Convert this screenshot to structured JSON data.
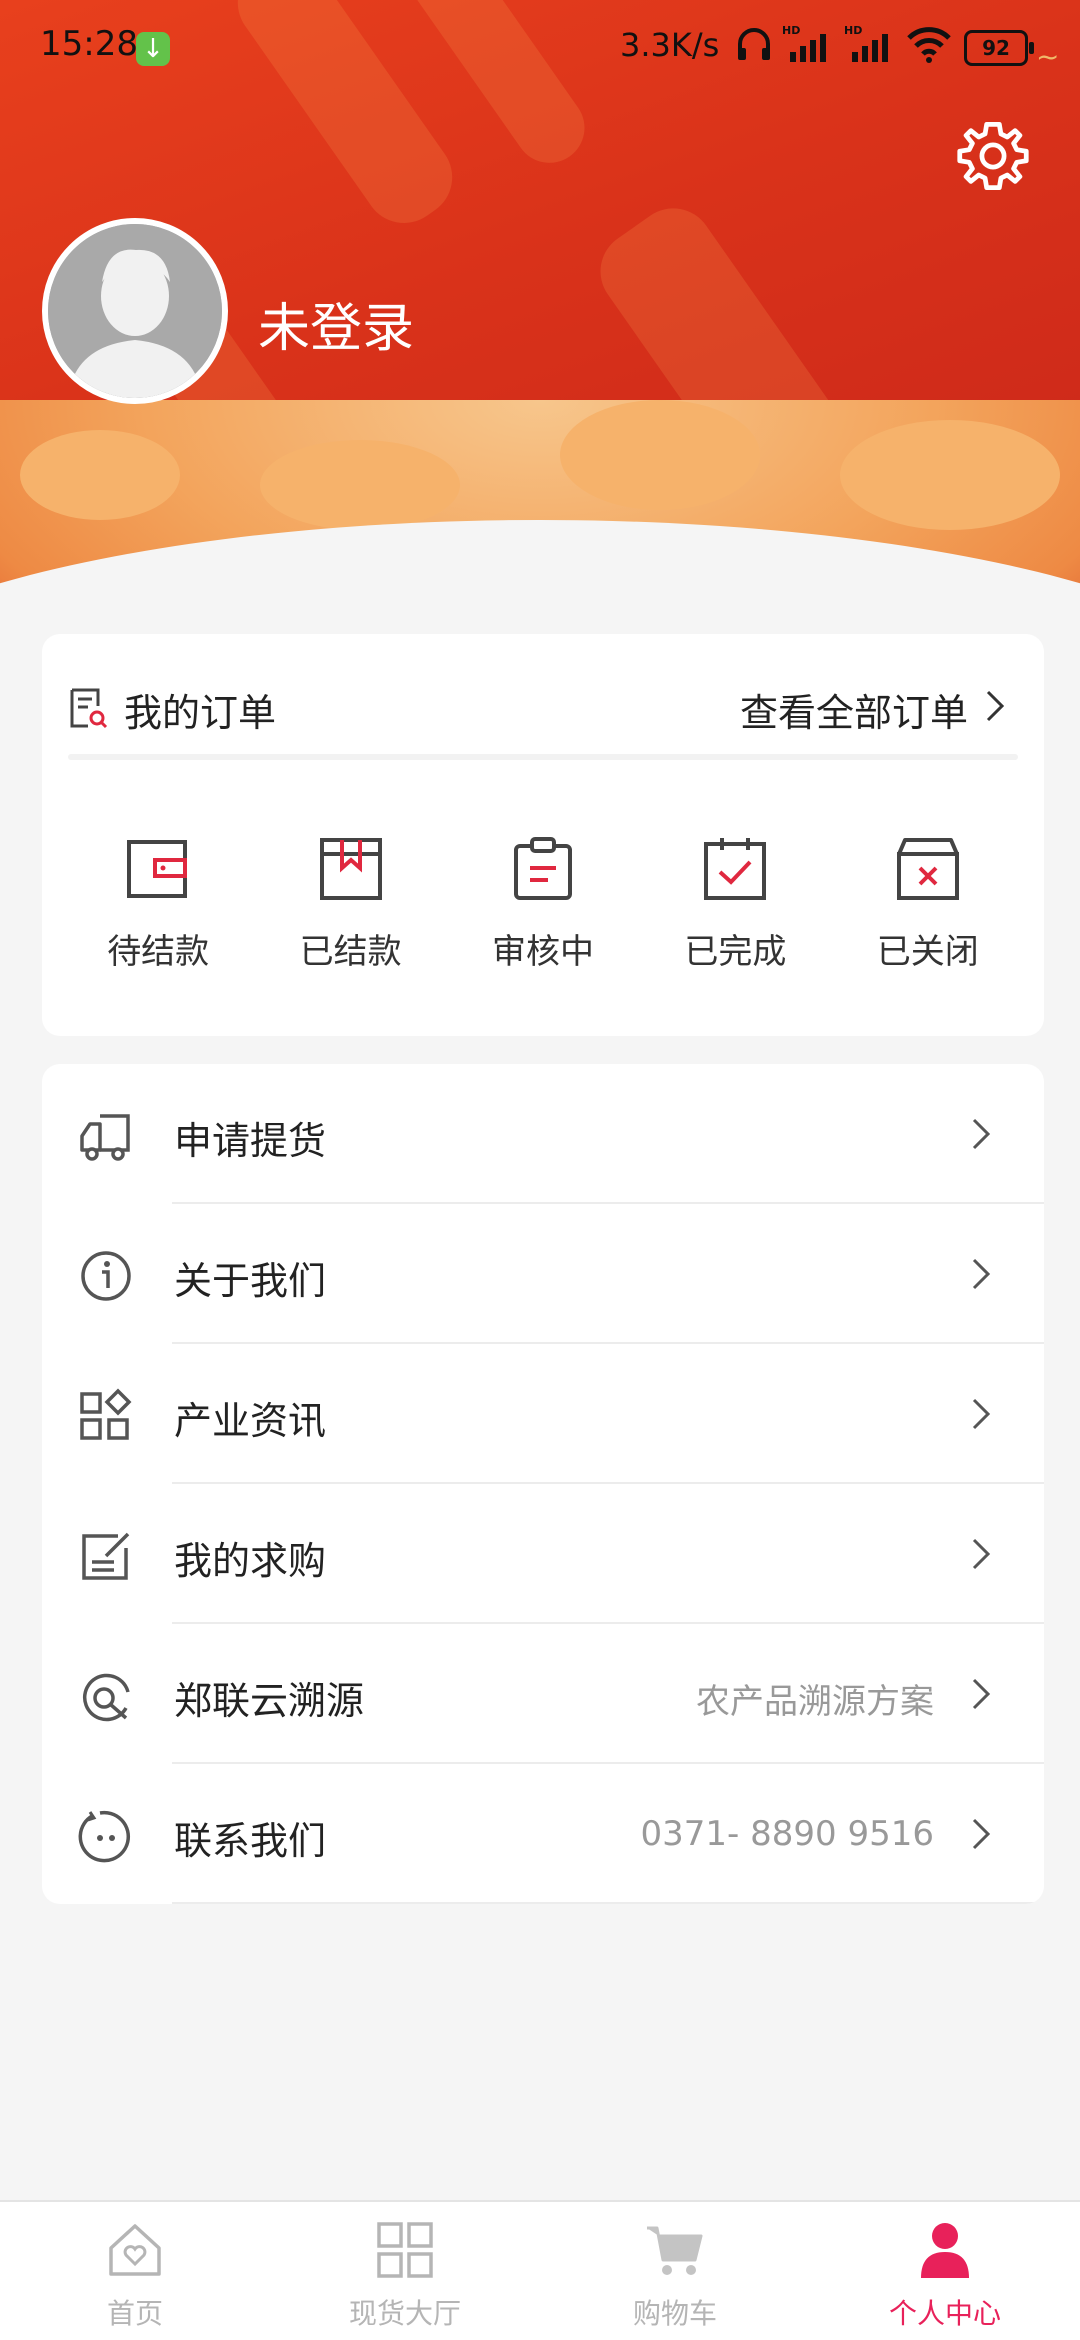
{
  "status_bar": {
    "time": "15:28",
    "speed": "3.3K/s",
    "battery": "92"
  },
  "profile": {
    "login_label": "未登录"
  },
  "orders": {
    "title": "我的订单",
    "view_all": "查看全部订单",
    "statuses": [
      {
        "label": "待结款",
        "icon": "wallet-icon"
      },
      {
        "label": "已结款",
        "icon": "bookmark-box-icon"
      },
      {
        "label": "审核中",
        "icon": "clipboard-icon"
      },
      {
        "label": "已完成",
        "icon": "calendar-check-icon"
      },
      {
        "label": "已关闭",
        "icon": "box-x-icon"
      }
    ]
  },
  "menu": [
    {
      "label": "申请提货",
      "value": "",
      "icon": "truck-icon"
    },
    {
      "label": "关于我们",
      "value": "",
      "icon": "info-icon"
    },
    {
      "label": "产业资讯",
      "value": "",
      "icon": "grid-diamond-icon"
    },
    {
      "label": "我的求购",
      "value": "",
      "icon": "edit-note-icon"
    },
    {
      "label": "郑联云溯源",
      "value": "农产品溯源方案",
      "icon": "target-icon"
    },
    {
      "label": "联系我们",
      "value": "0371- 8890 9516",
      "icon": "chat-face-icon"
    }
  ],
  "tabbar": [
    {
      "label": "首页",
      "icon": "home-heart-icon",
      "active": false
    },
    {
      "label": "现货大厅",
      "icon": "grid-icon",
      "active": false
    },
    {
      "label": "购物车",
      "icon": "cart-icon",
      "active": false
    },
    {
      "label": "个人中心",
      "icon": "person-icon",
      "active": true
    }
  ],
  "colors": {
    "header_red": "#d9321a",
    "accent_red": "#e8215a",
    "icon_red": "#e0283f",
    "icon_gray": "#555555"
  }
}
